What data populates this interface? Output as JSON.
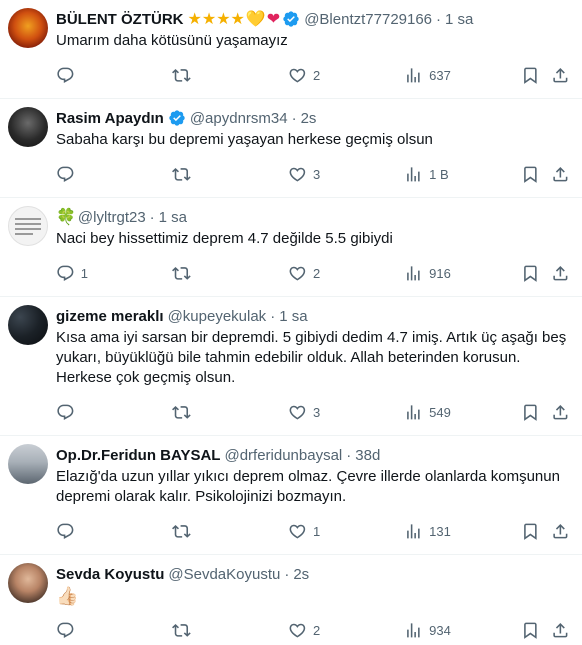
{
  "tweets": [
    {
      "name": "BÜLENT ÖZTÜRK",
      "badges": "★★★★",
      "handle": "@Blentzt77729166",
      "time": "1 sa",
      "text": "Umarım daha kötüsünü yaşamayız",
      "replies": "",
      "retweets": "",
      "likes": "2",
      "views": "637",
      "verified": true
    },
    {
      "name": "Rasim Apaydın",
      "handle": "@apydnrsm34",
      "time": "2s",
      "text": "Sabaha karşı bu depremi yaşayan herkese geçmiş olsun",
      "replies": "",
      "retweets": "",
      "likes": "3",
      "views": "1 B",
      "verified": true
    },
    {
      "name": "",
      "handle": "@lyltrgt23",
      "time": "1 sa",
      "text": "Naci bey hissettimiz deprem 4.7 değilde 5.5 gibiydi",
      "replies": "1",
      "retweets": "",
      "likes": "2",
      "views": "916",
      "verified": false
    },
    {
      "name": "gizeme meraklı",
      "handle": "@kupeyekulak",
      "time": "1 sa",
      "text": "Kısa ama iyi sarsan bir depremdi. 5 gibiydi dedim 4.7 imiş. Artık üç aşağı beş yukarı, büyüklüğü bile tahmin edebilir olduk. Allah beterinden korusun. Herkese çok geçmiş olsun.",
      "replies": "",
      "retweets": "",
      "likes": "3",
      "views": "549",
      "verified": false
    },
    {
      "name": "Op.Dr.Feridun BAYSAL",
      "handle": "@drferidunbaysal",
      "time": "38d",
      "text": "Elazığ'da uzun yıllar yıkıcı deprem olmaz. Çevre illerde olanlarda komşunun depremi olarak kalır. Psikolojinizi bozmayın.",
      "replies": "",
      "retweets": "",
      "likes": "1",
      "views": "131",
      "verified": false
    },
    {
      "name": "Sevda Koyustu",
      "handle": "@SevdaKoyustu",
      "time": "2s",
      "text": "👍🏻",
      "replies": "",
      "retweets": "",
      "likes": "2",
      "views": "934",
      "verified": false
    }
  ],
  "colors": {
    "text": "#0f1419",
    "muted": "#536471",
    "verified": "#1d9bf0",
    "border": "#eff3f4"
  },
  "icons": [
    "reply-icon",
    "retweet-icon",
    "like-icon",
    "views-icon",
    "bookmark-icon",
    "share-icon"
  ]
}
